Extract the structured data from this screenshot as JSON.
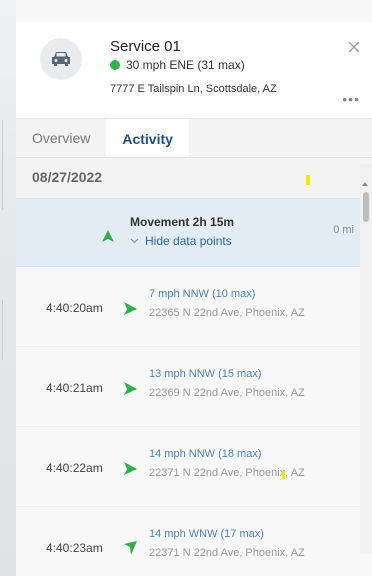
{
  "vehicle": {
    "icon": "car-icon",
    "name": "Service 01",
    "status_color": "#31b34a",
    "status_text": "30 mph ENE (31 max)",
    "address": "7777 E Tailspin Ln, Scottsdale, AZ"
  },
  "tabs": [
    {
      "label": "Overview",
      "active": false
    },
    {
      "label": "Activity",
      "active": true
    }
  ],
  "date": "08/27/2022",
  "movement": {
    "title": "Movement 2h 15m",
    "link_label": "Hide data points",
    "distance": "0 mi"
  },
  "points": [
    {
      "time": "4:40:20am",
      "speed": "7 mph NNW (10 max)",
      "address": "22365 N 22nd Ave, Phoenix, AZ",
      "heading": "NNW"
    },
    {
      "time": "4:40:21am",
      "speed": "13 mph NNW (15 max)",
      "address": "22369 N 22nd Ave, Phoenix, AZ",
      "heading": "NNW"
    },
    {
      "time": "4:40:22am",
      "speed": "14 mph NNW (18 max)",
      "address": "22371 N 22nd Ave, Phoenix, AZ",
      "heading": "NNW"
    },
    {
      "time": "4:40:23am",
      "speed": "14 mph WNW (17 max)",
      "address": "22371 N 22nd Ave, Phoenix, AZ",
      "heading": "WNW"
    }
  ],
  "colors": {
    "accent": "#1d4f8f",
    "link": "#2a64a8",
    "arrow": "#2fae4a",
    "movement_bg": "#e3ebf3"
  }
}
